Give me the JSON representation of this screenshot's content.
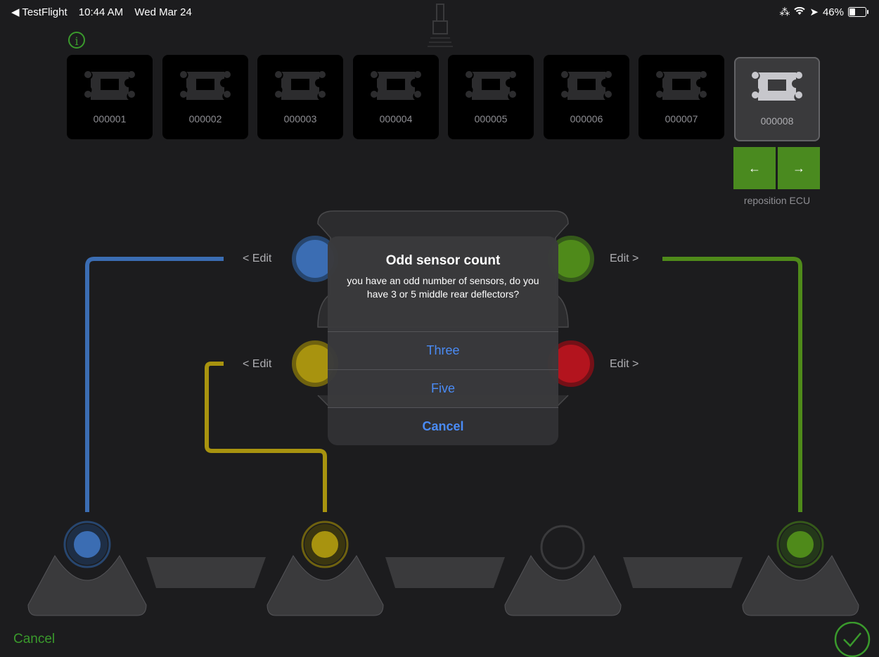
{
  "status_bar": {
    "back_app": "◀ TestFlight",
    "time": "10:44 AM",
    "date": "Wed Mar 24",
    "battery": "46%"
  },
  "ecus": [
    {
      "label": "000001"
    },
    {
      "label": "000002"
    },
    {
      "label": "000003"
    },
    {
      "label": "000004"
    },
    {
      "label": "000005"
    },
    {
      "label": "000006"
    },
    {
      "label": "000007"
    },
    {
      "label": "000008",
      "selected": true
    }
  ],
  "reposition": {
    "left_arrow": "←",
    "right_arrow": "→",
    "label": "reposition ECU"
  },
  "edits": {
    "left_top": "< Edit",
    "left_bottom": "< Edit",
    "right_top": "Edit >",
    "right_bottom": "Edit >"
  },
  "dialog": {
    "title": "Odd sensor count",
    "message": "you have an odd number of sensors, do you have 3 or 5 middle rear deflectors?",
    "option_three": "Three",
    "option_five": "Five",
    "cancel": "Cancel"
  },
  "footer": {
    "cancel": "Cancel"
  },
  "colors": {
    "blue": "#3b6db3",
    "yellow": "#a8930f",
    "green": "#4f8a1a",
    "red": "#b3141e",
    "accent": "#3a9a2c",
    "link": "#4a8bf5"
  }
}
